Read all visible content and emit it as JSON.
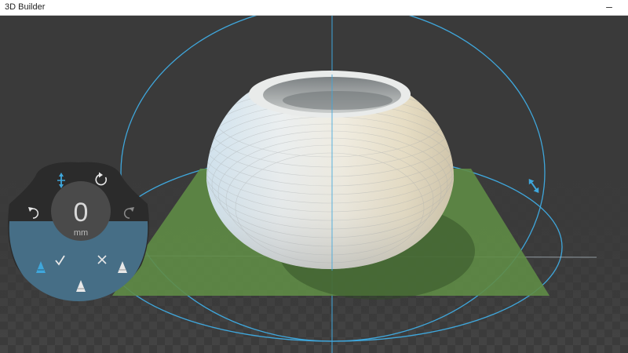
{
  "window": {
    "title": "3D Builder",
    "minimize_glyph": "–"
  },
  "toolwheel": {
    "value": "0",
    "unit": "mm",
    "icons": {
      "move_mode": "move-axis-icon",
      "rotate": "rotate-icon",
      "undo": "undo-icon",
      "redo": "redo-icon",
      "confirm": "checkmark-icon",
      "cancel": "close-icon",
      "axis_left": "axis-cone-icon",
      "axis_right": "axis-cone-icon",
      "axis_bottom": "axis-cone-icon"
    }
  },
  "scene": {
    "object": "hemisphere-bowl",
    "plane_color": "#5f8c46",
    "accent": "#3fa7dc"
  }
}
